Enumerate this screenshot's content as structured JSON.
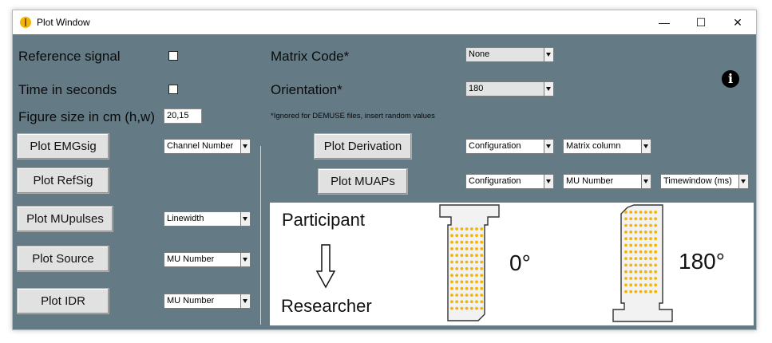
{
  "window": {
    "title": "Plot Window",
    "controls": {
      "minimize": "—",
      "maximize": "☐",
      "close": "✕"
    }
  },
  "settings": {
    "reference_signal_label": "Reference signal",
    "time_in_seconds_label": "Time in seconds",
    "figure_size_label": "Figure size in cm (h,w)",
    "figure_size_value": "20,15",
    "matrix_code_label": "Matrix Code*",
    "matrix_code_value": "None",
    "orientation_label": "Orientation*",
    "orientation_value": "180",
    "note": "*Ignored for DEMUSE files, insert random values"
  },
  "plots": {
    "emgsig": {
      "button": "Plot EMGsig",
      "dropdown": "Channel Number"
    },
    "refsig": {
      "button": "Plot RefSig"
    },
    "mupulses": {
      "button": "Plot MUpulses",
      "dropdown": "Linewidth"
    },
    "source": {
      "button": "Plot Source",
      "dropdown": "MU Number"
    },
    "idr": {
      "button": "Plot IDR",
      "dropdown": "MU Number"
    },
    "derivation": {
      "button": "Plot Derivation",
      "dropdown1": "Configuration",
      "dropdown2": "Matrix column"
    },
    "muaps": {
      "button": "Plot MUAPs",
      "dropdown1": "Configuration",
      "dropdown2": "MU Number",
      "dropdown3": "Timewindow (ms)"
    }
  },
  "figure": {
    "participant": "Participant",
    "researcher": "Researcher",
    "angle_0": "0°",
    "angle_180": "180°"
  },
  "colors": {
    "background": "#647b86",
    "electrode": "#f5b400",
    "icon": "#f5b400"
  },
  "icons": {
    "app": "app-icon",
    "info": "info-icon",
    "arrow": "down-arrow-icon"
  }
}
